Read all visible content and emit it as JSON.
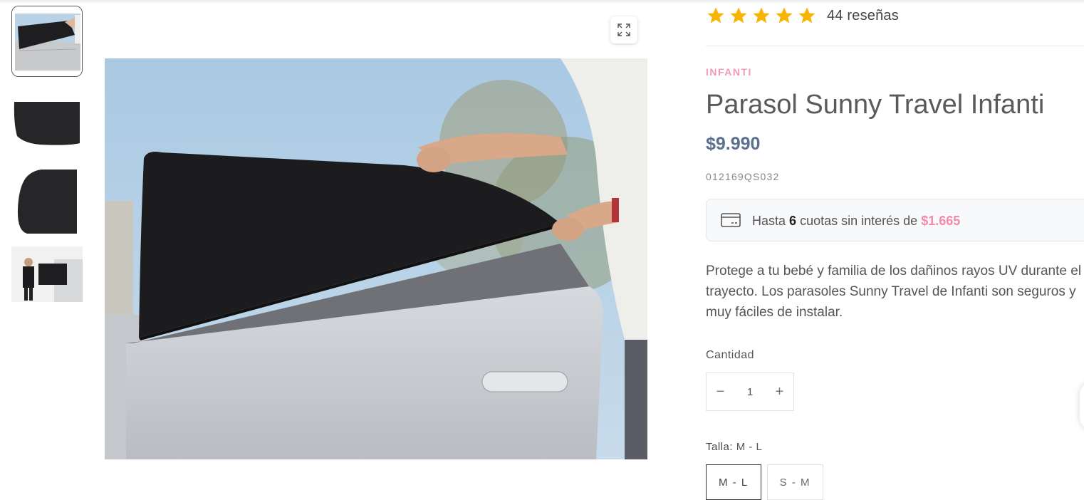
{
  "gallery": {
    "thumbnails": [
      {
        "name": "thumbnail-1-car-door-shade",
        "active": true
      },
      {
        "name": "thumbnail-2-shade-flat",
        "active": false
      },
      {
        "name": "thumbnail-3-shade-folded",
        "active": false
      },
      {
        "name": "thumbnail-4-man-with-car",
        "active": false
      }
    ],
    "expand_icon": "expand-icon"
  },
  "product": {
    "rating": {
      "stars": 5,
      "reviews_text": "44 reseñas",
      "star_color": "#f7b500"
    },
    "vendor": "INFANTI",
    "title": "Parasol Sunny Travel Infanti",
    "price": "$9.990",
    "sku": "012169QS032",
    "installments": {
      "prefix": "Hasta",
      "count": "6",
      "middle": "cuotas sin interés de",
      "amount": "$1.665"
    },
    "description": "Protege a tu bebé y familia de los dañinos rayos UV durante el trayecto. Los parasoles Sunny Travel de Infanti son seguros y muy fáciles de instalar.",
    "quantity": {
      "label": "Cantidad",
      "value": "1",
      "minus": "−",
      "plus": "+"
    },
    "size": {
      "label": "Talla:",
      "selected": "M - L",
      "options": [
        "M - L",
        "S - M"
      ]
    }
  },
  "colors": {
    "vendor": "#f29bb4",
    "price": "#5b6f8f",
    "installment_amount": "#f28aa7",
    "star": "#f7b500"
  }
}
